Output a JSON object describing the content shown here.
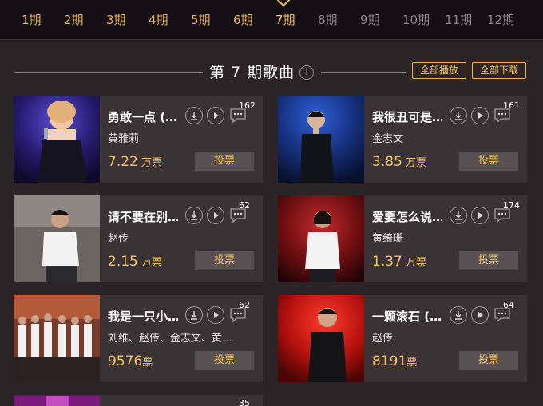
{
  "episodes": [
    {
      "label": "1期",
      "state": "past"
    },
    {
      "label": "2期",
      "state": "past"
    },
    {
      "label": "3期",
      "state": "past"
    },
    {
      "label": "4期",
      "state": "past"
    },
    {
      "label": "5期",
      "state": "past"
    },
    {
      "label": "6期",
      "state": "past"
    },
    {
      "label": "7期",
      "state": "active"
    },
    {
      "label": "8期",
      "state": "future"
    },
    {
      "label": "9期",
      "state": "future"
    },
    {
      "label": "10期",
      "state": "future"
    },
    {
      "label": "11期",
      "state": "future"
    },
    {
      "label": "12期",
      "state": "future"
    }
  ],
  "section": {
    "title": "第 7 期歌曲",
    "info_icon": "!",
    "play_all": "全部播放",
    "download_all": "全部下载"
  },
  "songs": [
    {
      "title": "勇敢一点 (…",
      "singer": "黄雅莉",
      "votes": "7.22",
      "unit": "万票",
      "comments": "162",
      "vote_label": "投票"
    },
    {
      "title": "我很丑可是…",
      "singer": "金志文",
      "votes": "3.85",
      "unit": "万票",
      "comments": "161",
      "vote_label": "投票"
    },
    {
      "title": "请不要在别…",
      "singer": "赵传",
      "votes": "2.15",
      "unit": "万票",
      "comments": "62",
      "vote_label": "投票"
    },
    {
      "title": "爱要怎么说…",
      "singer": "黄绮珊",
      "votes": "1.37",
      "unit": "万票",
      "comments": "174",
      "vote_label": "投票"
    },
    {
      "title": "我是一只小…",
      "singer": "刘维、赵传、金志文、黄…",
      "votes": "9576",
      "unit": "票",
      "comments": "62",
      "vote_label": "投票"
    },
    {
      "title": "一颗滚石 (…",
      "singer": "赵传",
      "votes": "8191",
      "unit": "票",
      "comments": "64",
      "vote_label": "投票"
    },
    {
      "title": "",
      "singer": "",
      "votes": "",
      "unit": "",
      "comments": "35",
      "vote_label": ""
    }
  ],
  "icons": {
    "download": "download-icon",
    "play": "play-icon",
    "comment": "comment-icon",
    "active_marker": "diamond-icon"
  },
  "colors": {
    "accent_gold": "#f3c261",
    "page_bg": "#2c2326",
    "card_bg": "#3b3235",
    "topbar_bg": "#150e14",
    "vote_button_bg": "#585053"
  }
}
